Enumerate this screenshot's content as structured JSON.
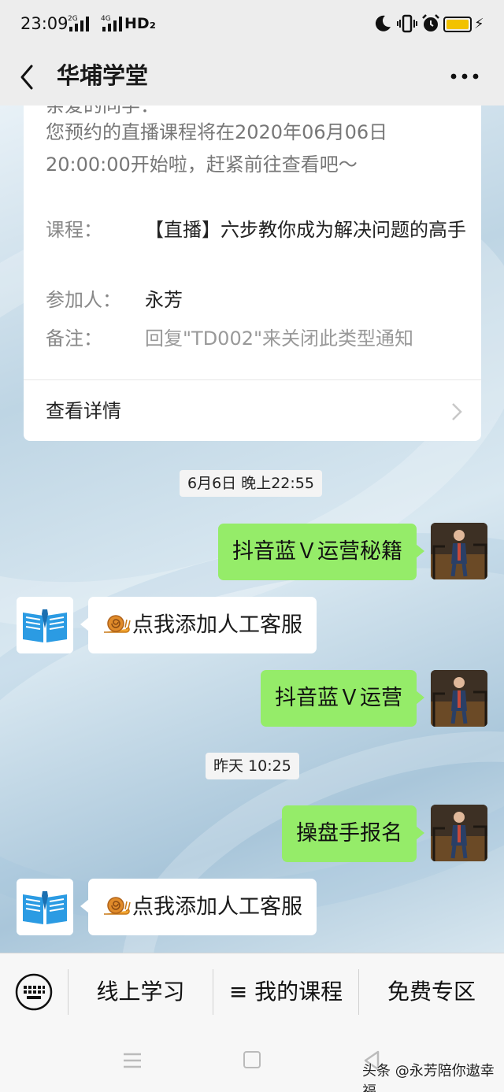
{
  "status_bar": {
    "time": "23:09",
    "network_2g": "2G",
    "network_4g": "4G",
    "hd": "HD₂"
  },
  "header": {
    "title": "华埔学堂"
  },
  "card": {
    "clipped_greeting": "亲爱的同学：",
    "intro": "您预约的直播课程将在2020年06月06日20:00:00开始啦，赶紧前往查看吧～",
    "course_key": "课程：",
    "course_value": "【直播】六步教你成为解决问题的高手",
    "attendee_key": "参加人：",
    "attendee_value": "永芳",
    "note_key": "备注：",
    "note_value": "回复\"TD002\"来关闭此类型通知",
    "detail_label": "查看详情"
  },
  "messages": {
    "stamp1": "6月6日 晚上22:55",
    "msg1": "抖音蓝Ｖ运营秘籍",
    "reply1": "点我添加人工客服",
    "msg2": "抖音蓝Ｖ运营",
    "stamp2": "昨天 10:25",
    "msg3": "操盘手报名",
    "reply2": "点我添加人工客服"
  },
  "menu": {
    "item1": "线上学习",
    "item2": "≡ 我的课程",
    "item3": "免费专区"
  },
  "watermark": "头条 @永芳陪你遨幸福",
  "colors": {
    "bubble_green": "#95ec69",
    "bar_grey": "#ededed",
    "logo_blue": "#2b9be3"
  }
}
